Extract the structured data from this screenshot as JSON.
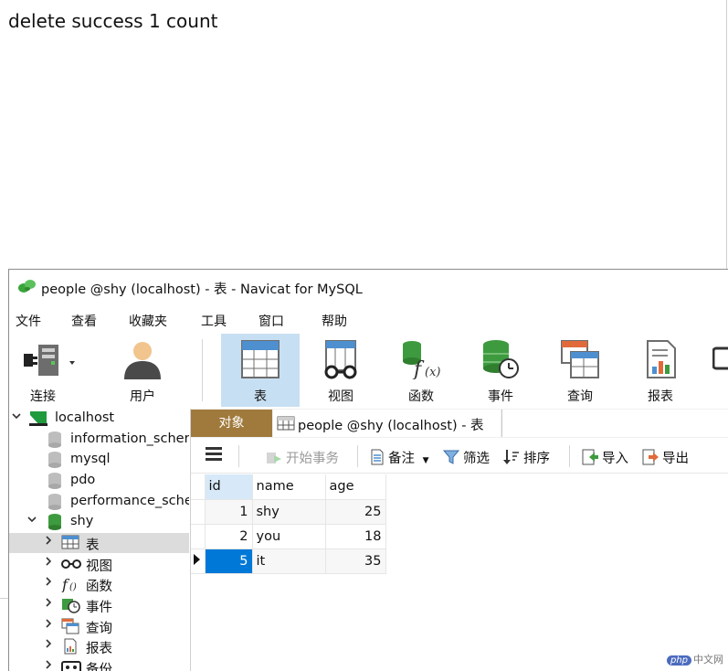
{
  "browser": {
    "message": "delete success 1 count"
  },
  "window": {
    "title": "people @shy (localhost) - 表 - Navicat for MySQL"
  },
  "menu": [
    "文件",
    "查看",
    "收藏夹",
    "工具",
    "窗口",
    "帮助"
  ],
  "ribbon": {
    "connect": "连接",
    "user": "用户",
    "table": "表",
    "view": "视图",
    "function": "函数",
    "event": "事件",
    "query": "查询",
    "report": "报表"
  },
  "tree": {
    "localhost": "localhost",
    "databases": [
      "information_scher",
      "mysql",
      "pdo",
      "performance_sche"
    ],
    "shy": "shy",
    "children": [
      "表",
      "视图",
      "函数",
      "事件",
      "查询",
      "报表",
      "备份"
    ]
  },
  "tabs": {
    "objects": "对象",
    "people": "people @shy (localhost) - 表"
  },
  "toolbar": {
    "begin_transaction": "开始事务",
    "comment": "备注",
    "filter": "筛选",
    "sort": "排序",
    "import": "导入",
    "export": "导出"
  },
  "grid": {
    "columns": [
      "id",
      "name",
      "age"
    ],
    "rows": [
      {
        "id": "1",
        "name": "shy",
        "age": "25"
      },
      {
        "id": "2",
        "name": "you",
        "age": "18"
      },
      {
        "id": "5",
        "name": "it",
        "age": "35"
      }
    ]
  },
  "watermark": {
    "logo": "php",
    "site": "中文网"
  },
  "colors": {
    "object_tab": "#a07a3c",
    "active_ribbon": "#c7dff2",
    "selection": "#0078d7",
    "header_highlight": "#d7e9f8"
  },
  "icons": [
    "navicat-logo-icon",
    "plug-icon",
    "user-icon",
    "table-icon",
    "view-icon",
    "function-icon",
    "event-icon",
    "query-icon",
    "report-icon",
    "database-icon",
    "hamburger-icon",
    "transaction-icon",
    "comment-icon",
    "filter-icon",
    "sort-icon",
    "import-icon",
    "export-icon",
    "backup-icon"
  ]
}
